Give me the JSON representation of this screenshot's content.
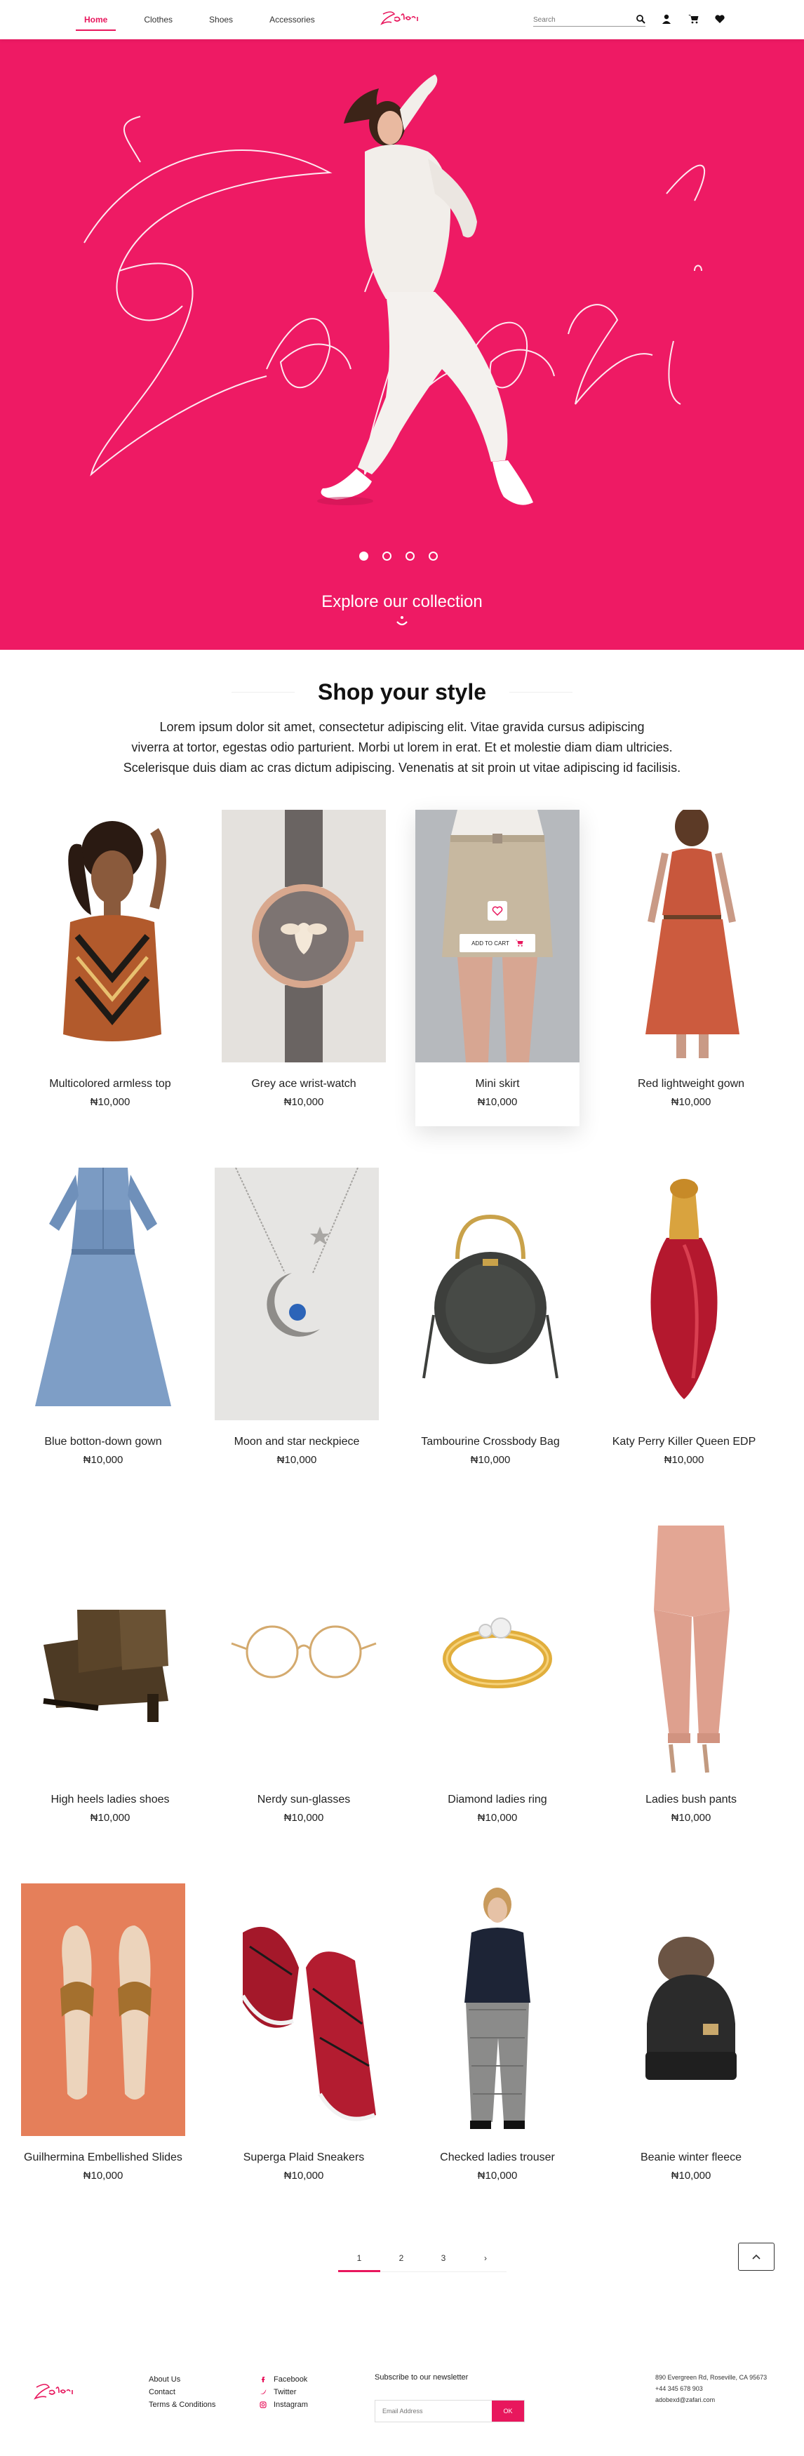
{
  "nav": {
    "links": [
      "Home",
      "Clothes",
      "Shoes",
      "Accessories"
    ],
    "logo": "Zafari",
    "search_placeholder": "Search"
  },
  "hero": {
    "cta": "Explore our collection",
    "slides": 4,
    "active_slide": 1,
    "background": "#ee1a64"
  },
  "section": {
    "title": "Shop your style",
    "desc_lines": [
      "Lorem ipsum dolor sit amet, consectetur adipiscing elit. Vitae gravida cursus adipiscing",
      "viverra at tortor, egestas odio parturient. Morbi ut lorem in erat. Et et molestie diam diam ultricies.",
      "Scelerisque duis diam ac cras dictum adipiscing. Venenatis at sit proin ut vitae adipiscing id facilisis."
    ]
  },
  "products": [
    {
      "name": "Multicolored armless top",
      "price": "₦10,000"
    },
    {
      "name": "Grey ace wrist-watch",
      "price": "₦10,000"
    },
    {
      "name": "Mini skirt",
      "price": "₦10,000",
      "hover": true,
      "add_to_cart": "ADD TO CART"
    },
    {
      "name": "Red lightweight gown",
      "price": "₦10,000"
    },
    {
      "name": "Blue botton-down gown",
      "price": "₦10,000"
    },
    {
      "name": "Moon and star neckpiece",
      "price": "₦10,000"
    },
    {
      "name": "Tambourine Crossbody Bag",
      "price": "₦10,000"
    },
    {
      "name": "Katy Perry Killer Queen EDP",
      "price": "₦10,000"
    },
    {
      "name": "High heels ladies shoes",
      "price": "₦10,000"
    },
    {
      "name": "Nerdy sun-glasses",
      "price": "₦10,000"
    },
    {
      "name": "Diamond ladies ring",
      "price": "₦10,000"
    },
    {
      "name": "Ladies bush pants",
      "price": "₦10,000"
    },
    {
      "name": "Guilhermina Embellished Slides",
      "price": "₦10,000"
    },
    {
      "name": "Superga Plaid Sneakers",
      "price": "₦10,000"
    },
    {
      "name": "Checked ladies trouser",
      "price": "₦10,000"
    },
    {
      "name": "Beanie winter fleece",
      "price": "₦10,000"
    }
  ],
  "pagination": {
    "pages": [
      "1",
      "2",
      "3"
    ],
    "current": "1",
    "next": "›"
  },
  "footer": {
    "logo": "Zafari",
    "links": [
      "About Us",
      "Contact",
      "Terms & Conditions"
    ],
    "social": [
      "Facebook",
      "Twitter",
      "Instagram"
    ],
    "subscribe_label": "Subscribe to our newsletter",
    "email_placeholder": "Email Address",
    "ok_label": "OK",
    "contact": [
      "890 Evergreen Rd, Roseville, CA 95673",
      "+44 345 678 903",
      "adobexd@zafari.com"
    ]
  },
  "colors": {
    "accent": "#e8175d",
    "hero": "#ee1a64"
  }
}
